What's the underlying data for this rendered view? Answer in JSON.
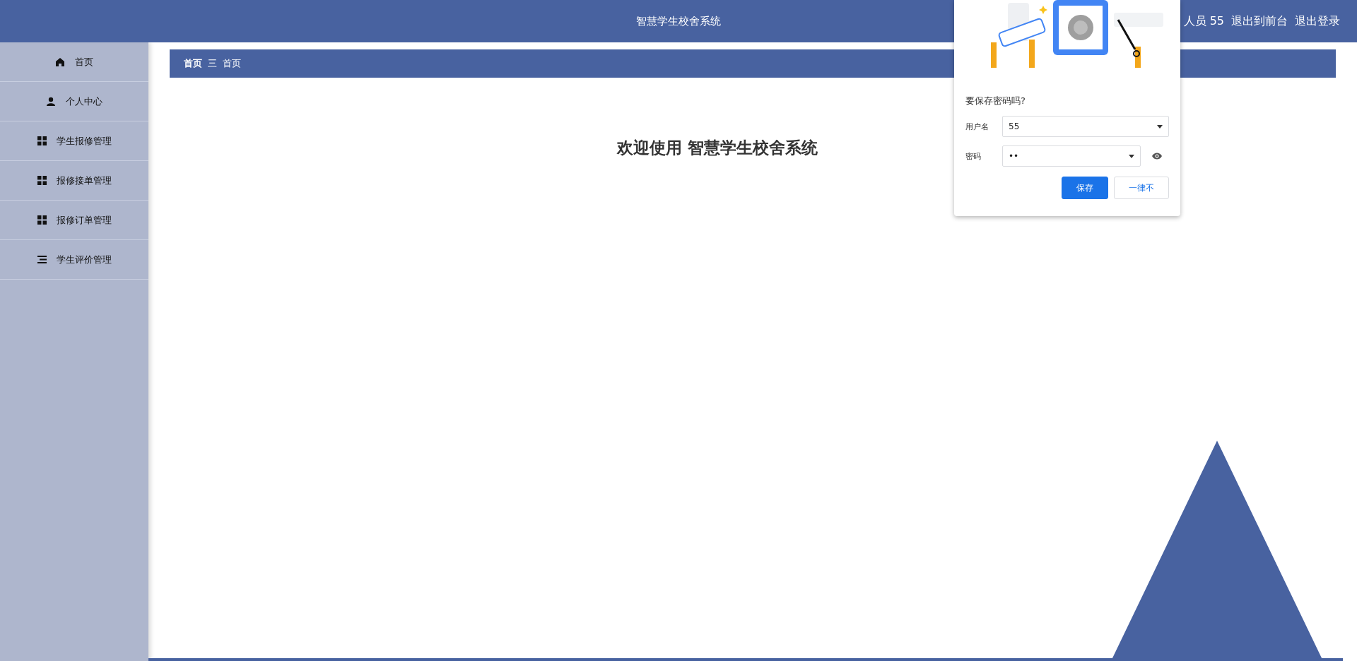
{
  "header": {
    "title": "智慧学生校舍系统",
    "user": "人员 55",
    "links": [
      "退出到前台",
      "退出登录"
    ]
  },
  "sidebar": {
    "items": [
      {
        "label": "首页",
        "kind": "home"
      },
      {
        "label": "个人中心",
        "kind": "person"
      },
      {
        "label": "学生报修管理",
        "kind": "grid"
      },
      {
        "label": "报修接单管理",
        "kind": "grid"
      },
      {
        "label": "报修订单管理",
        "kind": "grid"
      },
      {
        "label": "学生评价管理",
        "kind": "list"
      }
    ]
  },
  "breadcrumb": {
    "items": [
      "首页",
      "首页"
    ],
    "separator": "三"
  },
  "welcome": "欢迎使用 智慧学生校舍系统",
  "save_password_popup": {
    "question": "要保存密码吗?",
    "fields": [
      {
        "label": "用户名",
        "value": "55",
        "reveal": false
      },
      {
        "label": "密码",
        "value": "••",
        "reveal": true
      }
    ],
    "buttons": [
      {
        "label": "保存",
        "primary": true
      },
      {
        "label": "一律不",
        "primary": false
      }
    ]
  }
}
